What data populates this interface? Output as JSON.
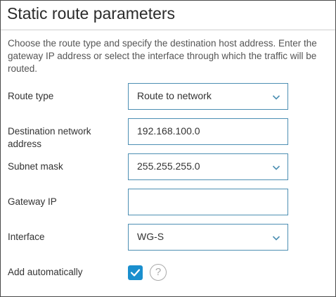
{
  "title": "Static route parameters",
  "description": "Choose the route type and specify the destination host address. Enter the gateway IP address or select the interface through which the traffic will be routed.",
  "fields": {
    "route_type": {
      "label": "Route type",
      "value": "Route to network",
      "icon": "chevron-down-icon"
    },
    "destination": {
      "label": "Destination network address",
      "value": "192.168.100.0"
    },
    "subnet_mask": {
      "label": "Subnet mask",
      "value": "255.255.255.0",
      "icon": "chevron-down-icon"
    },
    "gateway_ip": {
      "label": "Gateway IP",
      "value": ""
    },
    "interface": {
      "label": "Interface",
      "value": "WG-S",
      "icon": "chevron-down-icon"
    },
    "add_automatically": {
      "label": "Add automatically",
      "checked": true,
      "help_icon": "question-mark-icon",
      "help_glyph": "?"
    }
  },
  "colors": {
    "accent": "#1a8fce",
    "field_border": "#4d8fb3"
  }
}
